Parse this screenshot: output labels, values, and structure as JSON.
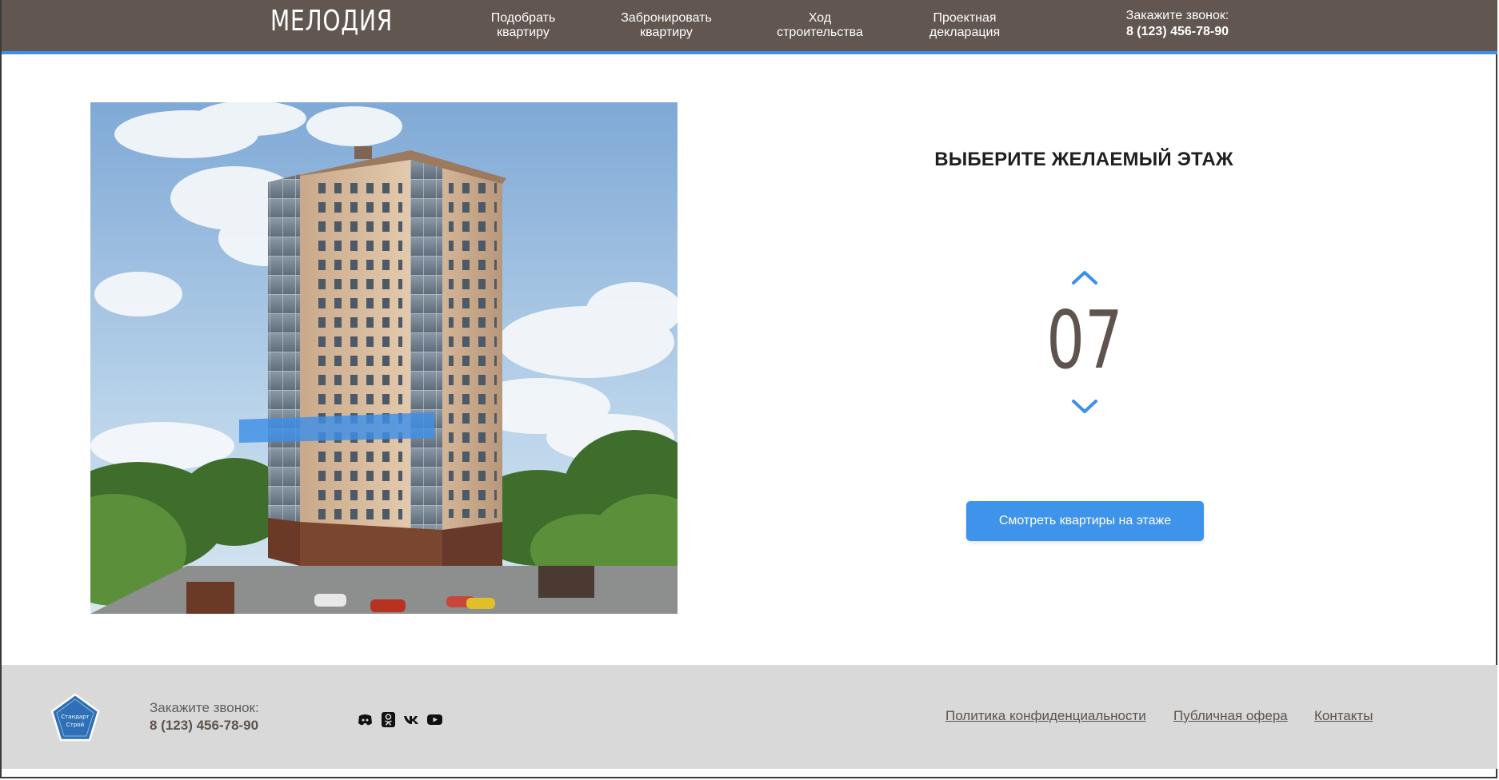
{
  "header": {
    "logo": "МЕЛОДИЯ",
    "nav": [
      {
        "label": "Подобрать\nквартиру"
      },
      {
        "label": "Забронировать\nквартиру"
      },
      {
        "label": "Ход\nстроительства"
      },
      {
        "label": "Проектная\nдекларация"
      }
    ],
    "callback_label": "Закажите звонок:",
    "callback_phone": "8 (123) 456-78-90"
  },
  "selector": {
    "title": "ВЫБЕРИТЕ ЖЕЛАЕМЫЙ ЭТАЖ",
    "floor": "07",
    "button_label": "Смотреть квартиры на этаже"
  },
  "footer": {
    "logo_text": "Стандарт Строй",
    "callback_label": "Закажите звонок:",
    "callback_phone": "8 (123) 456-78-90",
    "social_icons": [
      "discord-icon",
      "odnoklassniki-icon",
      "vk-icon",
      "youtube-icon"
    ],
    "links": [
      {
        "label": "Политика конфиденциальности"
      },
      {
        "label": "Публичная офера"
      },
      {
        "label": "Контакты"
      }
    ]
  },
  "colors": {
    "header_bg": "#615650",
    "accent": "#3e8fe8",
    "floor_highlight": "#3e8fe8",
    "footer_bg": "#d9d9d9",
    "text_brown": "#5e534d"
  }
}
